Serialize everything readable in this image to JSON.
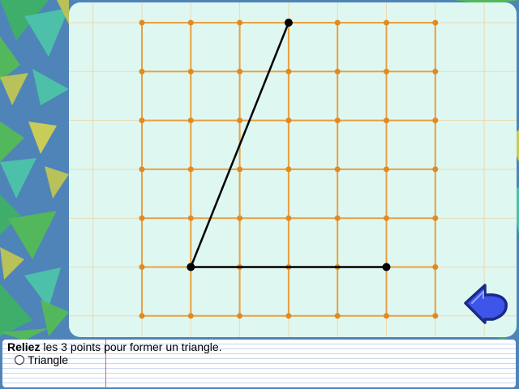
{
  "instruction": {
    "bold_word": "Reliez",
    "rest": " les 3 points pour former un triangle."
  },
  "options": [
    {
      "label": "Triangle",
      "selected": false
    }
  ],
  "colors": {
    "background": "#4f84b8",
    "board": "#dff7f1",
    "grid_line": "#e8a040",
    "grid_dot": "#e08a20",
    "segment": "#000000",
    "back_button": "#3d55e8"
  },
  "icons": {
    "back_button": "back-arrow-icon"
  },
  "grid": {
    "columns": 7,
    "rows": 7
  },
  "drawing": {
    "points": [
      {
        "col": 3,
        "row": 0
      },
      {
        "col": 1,
        "row": 5
      },
      {
        "col": 5,
        "row": 5
      }
    ],
    "segments": [
      [
        0,
        1
      ],
      [
        1,
        2
      ]
    ]
  }
}
